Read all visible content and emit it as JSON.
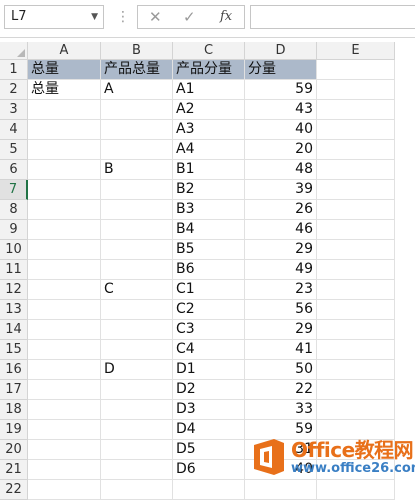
{
  "formula_bar": {
    "name_box": "L7",
    "dropdown_icon": "chevron-down-icon",
    "cancel_glyph": "✕",
    "enter_glyph": "✓",
    "fx_glyph": "fx",
    "formula": ""
  },
  "columns": [
    "A",
    "B",
    "C",
    "D",
    "E"
  ],
  "rows": [
    "1",
    "2",
    "3",
    "4",
    "5",
    "6",
    "7",
    "8",
    "9",
    "10",
    "11",
    "12",
    "13",
    "14",
    "15",
    "16",
    "17",
    "18",
    "19",
    "20",
    "21",
    "22"
  ],
  "active_row": "7",
  "header_row": [
    "总量",
    "产品总量",
    "产品分量",
    "分量"
  ],
  "data_rows": [
    [
      "总量",
      "A",
      "A1",
      "59"
    ],
    [
      "",
      "",
      "A2",
      "43"
    ],
    [
      "",
      "",
      "A3",
      "40"
    ],
    [
      "",
      "",
      "A4",
      "20"
    ],
    [
      "",
      "B",
      "B1",
      "48"
    ],
    [
      "",
      "",
      "B2",
      "39"
    ],
    [
      "",
      "",
      "B3",
      "26"
    ],
    [
      "",
      "",
      "B4",
      "46"
    ],
    [
      "",
      "",
      "B5",
      "29"
    ],
    [
      "",
      "",
      "B6",
      "49"
    ],
    [
      "",
      "C",
      "C1",
      "23"
    ],
    [
      "",
      "",
      "C2",
      "56"
    ],
    [
      "",
      "",
      "C3",
      "29"
    ],
    [
      "",
      "",
      "C4",
      "41"
    ],
    [
      "",
      "D",
      "D1",
      "50"
    ],
    [
      "",
      "",
      "D2",
      "22"
    ],
    [
      "",
      "",
      "D3",
      "33"
    ],
    [
      "",
      "",
      "D4",
      "59"
    ],
    [
      "",
      "",
      "D5",
      "31"
    ],
    [
      "",
      "",
      "D6",
      "40"
    ]
  ],
  "colors": {
    "header_fill": "#acb9ca",
    "accent": "#217346",
    "watermark_orange": "#e8701a",
    "watermark_blue": "#3a7fc4"
  },
  "watermark": {
    "title": "Office教程网",
    "url": "www.office26.com"
  }
}
